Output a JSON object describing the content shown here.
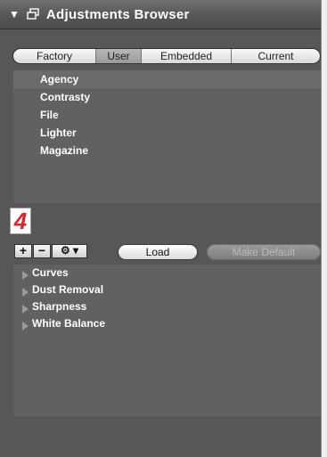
{
  "window": {
    "title": "Adjustments Browser",
    "collapse_icon": "disclosure-triangle-down-icon",
    "panel_icon": "panel-icon"
  },
  "tabs": [
    {
      "label": "Factory",
      "active": false
    },
    {
      "label": "User",
      "active": true
    },
    {
      "label": "Embedded",
      "active": false
    },
    {
      "label": "Current",
      "active": false
    }
  ],
  "presets": [
    {
      "label": "Agency",
      "selected": true
    },
    {
      "label": "Contrasty",
      "selected": false
    },
    {
      "label": "File",
      "selected": false
    },
    {
      "label": "Lighter",
      "selected": false
    },
    {
      "label": "Magazine",
      "selected": false
    }
  ],
  "badge": {
    "number": "4",
    "color": "#d2282e"
  },
  "toolbar": {
    "add_label": "+",
    "remove_label": "−",
    "gear_label": "⚙ ▾",
    "load_label": "Load",
    "make_default_label": "Make Default"
  },
  "adjustments": [
    {
      "label": "Curves"
    },
    {
      "label": "Dust Removal"
    },
    {
      "label": "Sharpness"
    },
    {
      "label": "White Balance"
    }
  ]
}
